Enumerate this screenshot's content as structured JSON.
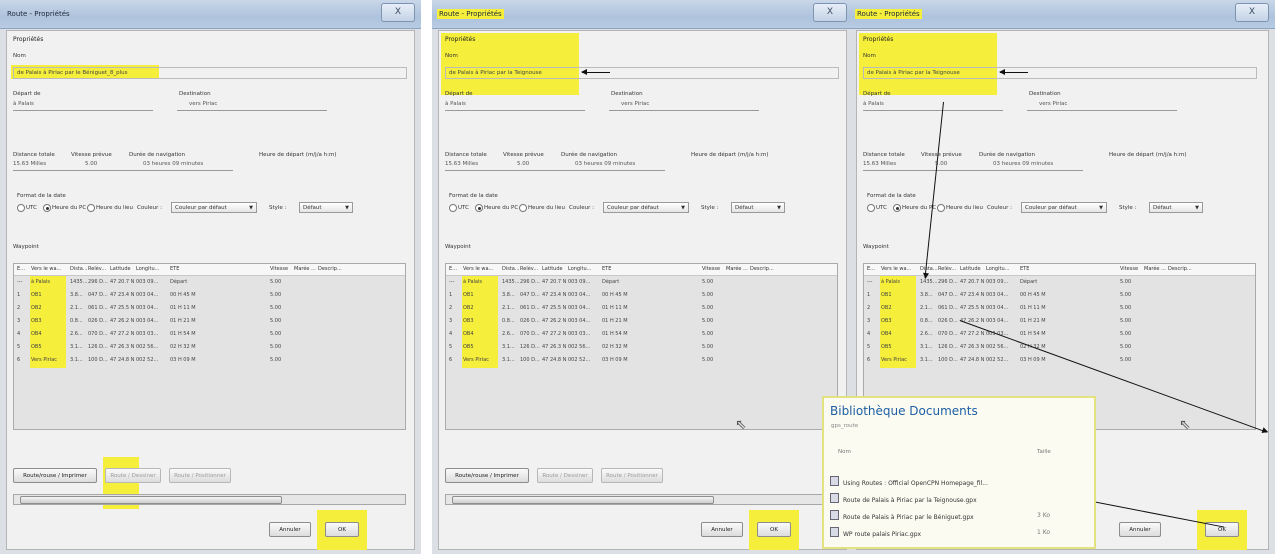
{
  "window_title": "Route - Propriétés",
  "close_label": "X",
  "section_properties": "Propriétés",
  "labels": {
    "nom": "Nom",
    "depart": "Départ de",
    "destination": "Destination",
    "distance": "Distance totale",
    "vitesse": "Vitesse prévue",
    "duree": "Durée de navigation",
    "heure_depart": "Heure de départ (m/j/a h:m)",
    "format_date": "Format de la date",
    "couleur": "Couleur :",
    "style": "Style :",
    "waypoint": "Waypoint"
  },
  "values": {
    "depart": "à Palais",
    "destination": "vers Piriac",
    "distance": "15.63 Milles",
    "vitesse": "5.00",
    "duree": "03 heures 09 minutes"
  },
  "radio": {
    "utc": "UTC",
    "pc": "Heure du PC",
    "lieu": "Heure du lieu",
    "selected": "pc"
  },
  "color_select": "Couleur par défaut",
  "style_select": "Défaut",
  "name_values": [
    "de Palais à Piriac par le Béniguet_8_plus",
    "de Palais à Piriac par la Teignouse",
    "de Palais à Piriac par la Teignouse"
  ],
  "columns": [
    "E...",
    "Vers le wa...",
    "Dista...",
    "Relèv...",
    "Latitude",
    "Longitu...",
    "ETE",
    "Vitesse",
    "Marée ...",
    "Descrip..."
  ],
  "rows": [
    [
      "---",
      "à Palais",
      "1435...",
      "296 D...",
      "47 20.7 N",
      "003 09...",
      "Départ",
      "5.00"
    ],
    [
      "1",
      "OB1",
      "3.8...",
      "047 D...",
      "47 23.4 N",
      "003 04...",
      "00 H 45 M",
      "5.00"
    ],
    [
      "2",
      "OB2",
      "2.1...",
      "061 D...",
      "47 25.5 N",
      "003 04...",
      "01 H 11 M",
      "5.00"
    ],
    [
      "3",
      "OB3",
      "0.8...",
      "026 D...",
      "47 26.2 N",
      "003 04...",
      "01 H 21 M",
      "5.00"
    ],
    [
      "4",
      "OB4",
      "2.6...",
      "070 D...",
      "47 27.2 N",
      "003 03...",
      "01 H 54 M",
      "5.00"
    ],
    [
      "5",
      "OB5",
      "3.1...",
      "126 D...",
      "47 26.3 N",
      "002 56...",
      "02 H 32 M",
      "5.00"
    ],
    [
      "6",
      "Vers Piriac",
      "3.1...",
      "100 D...",
      "47 24.8 N",
      "002 52...",
      "03 H 09 M",
      "5.00"
    ]
  ],
  "buttons": {
    "print": "Route/rouse / Imprimer",
    "tracer": "Route / Dessiner",
    "positionner": "Route / Positionner",
    "annuler": "Annuler",
    "ok": "OK"
  },
  "popup": {
    "title": "Bibliothèque Documents",
    "subtitle": "gps_route",
    "col_name": "Nom",
    "col_size": "Taille",
    "files": [
      {
        "name": "Using Routes : Official OpenCPN Homepage_fil...",
        "size": ""
      },
      {
        "name": "Route de Palais à Piriac par la Teignouse.gpx",
        "size": ""
      },
      {
        "name": "Route de Palais à Piriac par le Béniguet.gpx",
        "size": "3 Ko"
      },
      {
        "name": "WP route palais Piriac.gpx",
        "size": "1 Ko"
      }
    ]
  },
  "highlight_color": "#f5ee3a"
}
